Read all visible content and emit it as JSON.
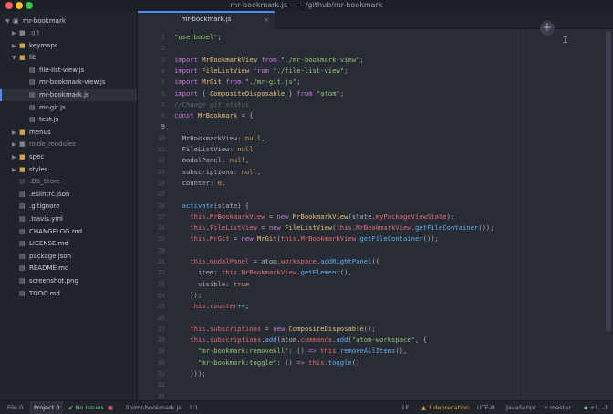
{
  "window": {
    "title": "mr-bookmark.js — ~/github/mr-bookmark"
  },
  "tree": {
    "root": "mr-bookmark",
    "items": [
      {
        "label": ".git",
        "type": "folder",
        "expanded": false,
        "depth": 1,
        "muted": true
      },
      {
        "label": "keymaps",
        "type": "folder",
        "expanded": false,
        "depth": 1,
        "muted": false
      },
      {
        "label": "lib",
        "type": "folder",
        "expanded": true,
        "depth": 1,
        "muted": false
      },
      {
        "label": "file-list-view.js",
        "type": "file",
        "depth": 2,
        "muted": false
      },
      {
        "label": "mr-bookmark-view.js",
        "type": "file",
        "depth": 2,
        "muted": false
      },
      {
        "label": "mr-bookmark.js",
        "type": "file",
        "depth": 2,
        "muted": false,
        "selected": true
      },
      {
        "label": "mr-git.js",
        "type": "file",
        "depth": 2,
        "muted": false
      },
      {
        "label": "test.js",
        "type": "file",
        "depth": 2,
        "muted": false
      },
      {
        "label": "menus",
        "type": "folder",
        "expanded": false,
        "depth": 1,
        "muted": false
      },
      {
        "label": "node_modules",
        "type": "folder",
        "expanded": false,
        "depth": 1,
        "muted": true
      },
      {
        "label": "spec",
        "type": "folder",
        "expanded": false,
        "depth": 1,
        "muted": false
      },
      {
        "label": "styles",
        "type": "folder",
        "expanded": false,
        "depth": 1,
        "muted": false
      },
      {
        "label": ".DS_Store",
        "type": "file",
        "depth": 1,
        "muted": true
      },
      {
        "label": ".eslintrc.json",
        "type": "file",
        "depth": 1,
        "muted": false
      },
      {
        "label": ".gitignore",
        "type": "file",
        "depth": 1,
        "muted": false
      },
      {
        "label": ".travis.yml",
        "type": "file",
        "depth": 1,
        "muted": false
      },
      {
        "label": "CHANGELOG.md",
        "type": "file",
        "depth": 1,
        "muted": false
      },
      {
        "label": "LICENSE.md",
        "type": "file",
        "depth": 1,
        "muted": false
      },
      {
        "label": "package.json",
        "type": "file",
        "depth": 1,
        "muted": false
      },
      {
        "label": "README.md",
        "type": "file",
        "depth": 1,
        "muted": false
      },
      {
        "label": "screenshot.png",
        "type": "file",
        "depth": 1,
        "muted": false
      },
      {
        "label": "TODO.md",
        "type": "file",
        "depth": 1,
        "muted": false
      }
    ]
  },
  "tab": {
    "label": "mr-bookmark.js"
  },
  "editor": {
    "active_line": 9,
    "lines": [
      [
        [
          "s",
          "\"use babel\""
        ],
        [
          "p",
          ";"
        ]
      ],
      [],
      [
        [
          "k",
          "import "
        ],
        [
          "t",
          "MrBookmarkView"
        ],
        [
          "k",
          " from "
        ],
        [
          "s",
          "\"./mr-bookmark-view\""
        ],
        [
          "p",
          ";"
        ]
      ],
      [
        [
          "k",
          "import "
        ],
        [
          "t",
          "FileListView"
        ],
        [
          "k",
          " from "
        ],
        [
          "s",
          "\"./file-list-view\""
        ],
        [
          "p",
          ";"
        ]
      ],
      [
        [
          "k",
          "import "
        ],
        [
          "t",
          "MrGit"
        ],
        [
          "k",
          " from "
        ],
        [
          "s",
          "\"./mr-git.js\""
        ],
        [
          "p",
          ";"
        ]
      ],
      [
        [
          "k",
          "import "
        ],
        [
          "p",
          "{ "
        ],
        [
          "t",
          "CompositeDisposable"
        ],
        [
          "p",
          " } "
        ],
        [
          "k",
          "from "
        ],
        [
          "s",
          "\"atom\""
        ],
        [
          "p",
          ";"
        ]
      ],
      [
        [
          "c",
          "//Change git status"
        ]
      ],
      [
        [
          "k",
          "const "
        ],
        [
          "t",
          "MrBookmark"
        ],
        [
          "p",
          " = {"
        ]
      ],
      [],
      [
        [
          "p",
          "  MrBookmarkView: "
        ],
        [
          "n",
          "null"
        ],
        [
          "p",
          ","
        ]
      ],
      [
        [
          "p",
          "  FileListView: "
        ],
        [
          "n",
          "null"
        ],
        [
          "p",
          ","
        ]
      ],
      [
        [
          "p",
          "  modalPanel: "
        ],
        [
          "n",
          "null"
        ],
        [
          "p",
          ","
        ]
      ],
      [
        [
          "p",
          "  subscriptions: "
        ],
        [
          "n",
          "null"
        ],
        [
          "p",
          ","
        ]
      ],
      [
        [
          "p",
          "  counter: "
        ],
        [
          "n",
          "0"
        ],
        [
          "p",
          ","
        ]
      ],
      [],
      [
        [
          "f",
          "  activate"
        ],
        [
          "p",
          "(state) {"
        ]
      ],
      [
        [
          "v",
          "    this"
        ],
        [
          "p",
          "."
        ],
        [
          "v",
          "MrBookmarkView"
        ],
        [
          "p",
          " = "
        ],
        [
          "k",
          "new "
        ],
        [
          "t",
          "MrBookmarkView"
        ],
        [
          "p",
          "(state."
        ],
        [
          "v",
          "myPackageViewState"
        ],
        [
          "p",
          ");"
        ]
      ],
      [
        [
          "v",
          "    this"
        ],
        [
          "p",
          "."
        ],
        [
          "v",
          "FileListView"
        ],
        [
          "p",
          " = "
        ],
        [
          "k",
          "new "
        ],
        [
          "t",
          "FileListView"
        ],
        [
          "p",
          "("
        ],
        [
          "v",
          "this"
        ],
        [
          "p",
          "."
        ],
        [
          "v",
          "MrBookmarkView"
        ],
        [
          "p",
          "."
        ],
        [
          "f",
          "getFileContainer"
        ],
        [
          "p",
          "());"
        ]
      ],
      [
        [
          "v",
          "    this"
        ],
        [
          "p",
          "."
        ],
        [
          "v",
          "MrGit"
        ],
        [
          "p",
          " = "
        ],
        [
          "k",
          "new "
        ],
        [
          "t",
          "MrGit"
        ],
        [
          "p",
          "("
        ],
        [
          "v",
          "this"
        ],
        [
          "p",
          "."
        ],
        [
          "v",
          "MrBookmarkView"
        ],
        [
          "p",
          "."
        ],
        [
          "f",
          "getFileContainer"
        ],
        [
          "p",
          "());"
        ]
      ],
      [],
      [
        [
          "v",
          "    this"
        ],
        [
          "p",
          "."
        ],
        [
          "v",
          "modalPanel"
        ],
        [
          "p",
          " = atom."
        ],
        [
          "v",
          "workspace"
        ],
        [
          "p",
          "."
        ],
        [
          "f",
          "addRightPanel"
        ],
        [
          "p",
          "({"
        ]
      ],
      [
        [
          "p",
          "      item: "
        ],
        [
          "v",
          "this"
        ],
        [
          "p",
          "."
        ],
        [
          "v",
          "MrBookmarkView"
        ],
        [
          "p",
          "."
        ],
        [
          "f",
          "getElement"
        ],
        [
          "p",
          "(),"
        ]
      ],
      [
        [
          "p",
          "      visible: "
        ],
        [
          "n",
          "true"
        ]
      ],
      [
        [
          "p",
          "    });"
        ]
      ],
      [
        [
          "v",
          "    this"
        ],
        [
          "p",
          "."
        ],
        [
          "v",
          "counter"
        ],
        [
          "o",
          "++"
        ],
        [
          "p",
          ";"
        ]
      ],
      [],
      [
        [
          "v",
          "    this"
        ],
        [
          "p",
          "."
        ],
        [
          "v",
          "subscriptions"
        ],
        [
          "p",
          " = "
        ],
        [
          "k",
          "new "
        ],
        [
          "t",
          "CompositeDisposable"
        ],
        [
          "p",
          "();"
        ]
      ],
      [
        [
          "v",
          "    this"
        ],
        [
          "p",
          "."
        ],
        [
          "v",
          "subscriptions"
        ],
        [
          "p",
          "."
        ],
        [
          "f",
          "add"
        ],
        [
          "p",
          "(atom."
        ],
        [
          "v",
          "commands"
        ],
        [
          "p",
          "."
        ],
        [
          "f",
          "add"
        ],
        [
          "p",
          "("
        ],
        [
          "s",
          "\"atom-workspace\""
        ],
        [
          "p",
          ", {"
        ]
      ],
      [
        [
          "s",
          "      \"mr-bookmark:removeAll\""
        ],
        [
          "p",
          ": () "
        ],
        [
          "k",
          "=>"
        ],
        [
          "v",
          " this"
        ],
        [
          "p",
          "."
        ],
        [
          "f",
          "removeAllItems"
        ],
        [
          "p",
          "(),"
        ]
      ],
      [
        [
          "s",
          "      \"mr-bookmark:toggle\""
        ],
        [
          "p",
          ": () "
        ],
        [
          "k",
          "=>"
        ],
        [
          "v",
          " this"
        ],
        [
          "p",
          "."
        ],
        [
          "f",
          "toggle"
        ],
        [
          "p",
          "()"
        ]
      ],
      [
        [
          "p",
          "    }));"
        ]
      ],
      [],
      [
        [
          "p",
          "    "
        ]
      ]
    ]
  },
  "status": {
    "file_label": "File",
    "file_count": "0",
    "project_label": "Project",
    "project_count": "0",
    "no_issues": "No Issues",
    "path": "lib/mr-bookmark.js",
    "cursor": "1:1",
    "line_ending": "LF",
    "deprecation": "1 deprecation",
    "encoding": "UTF-8",
    "grammar": "JavaScript",
    "branch": "master",
    "diff": "+1, -1"
  },
  "colors": {
    "accent": "#528bff",
    "folder": "#d4a34c",
    "green": "#73c990",
    "orange": "#e5a03c"
  }
}
